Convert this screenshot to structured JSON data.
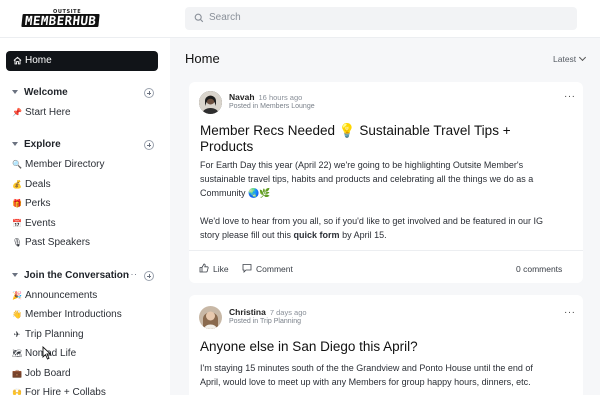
{
  "brand": {
    "logo_small": "OUTSITE",
    "logo_big": "MEMBERHUB"
  },
  "search": {
    "placeholder": "Search"
  },
  "sidebar": {
    "home": "Home",
    "sections": [
      {
        "title": "Welcome",
        "items": [
          {
            "icon": "📌",
            "label": "Start Here"
          }
        ]
      },
      {
        "title": "Explore",
        "items": [
          {
            "icon": "🔍",
            "label": "Member Directory"
          },
          {
            "icon": "💰",
            "label": "Deals"
          },
          {
            "icon": "🎁",
            "label": "Perks"
          },
          {
            "icon": "📅",
            "label": "Events"
          },
          {
            "icon": "🎙️",
            "label": "Past Speakers"
          }
        ]
      },
      {
        "title": "Join the Conversation",
        "more": "···",
        "items": [
          {
            "icon": "🎉",
            "label": "Announcements"
          },
          {
            "icon": "👋",
            "label": "Member Introductions"
          },
          {
            "icon": "✈️",
            "label": "Trip Planning"
          },
          {
            "icon": "🗺️",
            "label": "Nomad Life"
          },
          {
            "icon": "💼",
            "label": "Job Board"
          },
          {
            "icon": "🙌",
            "label": "For Hire + Collabs"
          }
        ]
      }
    ]
  },
  "main": {
    "title": "Home",
    "sort": "Latest",
    "posts": [
      {
        "author": "Navah",
        "time": "16 hours ago",
        "posted_in": "Posted in Members Lounge",
        "more": "···",
        "title_line1": "Member Recs Needed 💡 Sustainable Travel Tips +",
        "title_line2": "Products",
        "body": [
          "For Earth Day this year (April 22) we're going to be highlighting Outsite Member's",
          "sustainable travel tips, habits and products and celebrating all the things we do as a",
          "Community 🌏🌿",
          "",
          "We'd love to hear from you all, so if you'd like to get involved and be featured in our IG",
          "story please fill out this "
        ],
        "body_link": "quick form",
        "body_tail": " by April 15.",
        "like": "Like",
        "comment": "Comment",
        "comments_count": "0 comments"
      },
      {
        "author": "Christina",
        "time": "7 days ago",
        "posted_in": "Posted in Trip Planning",
        "more": "···",
        "title_line1": "Anyone else in San Diego this April?",
        "body": [
          "I'm staying 15 minutes south of the the Grandview and Ponto House until the end of",
          "April, would love to meet up with any Members for group happy hours, dinners, etc."
        ]
      }
    ]
  },
  "colors": {
    "nav_active_bg": "#111418",
    "main_bg": "#f6f7f9"
  }
}
